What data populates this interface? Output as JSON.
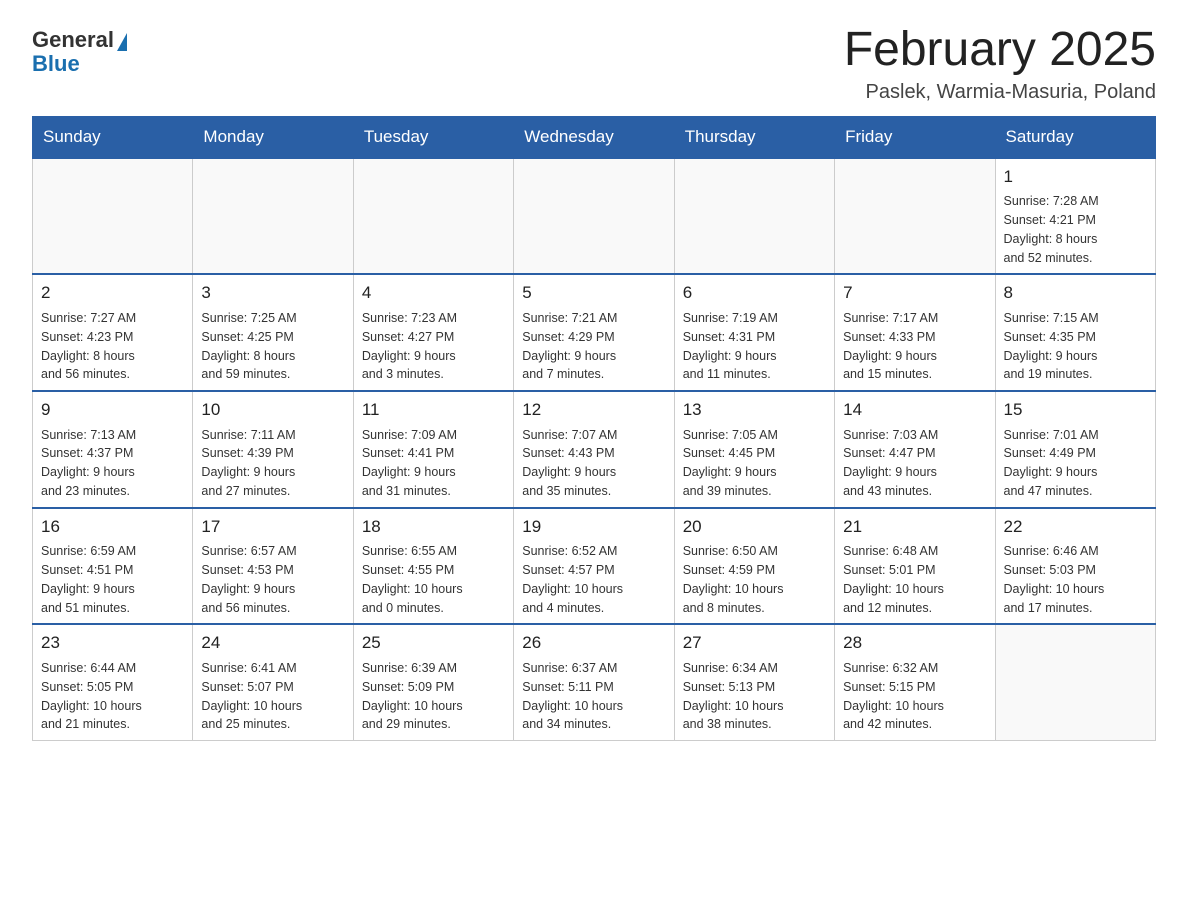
{
  "logo": {
    "general": "General",
    "blue": "Blue",
    "arrow_symbol": "▶"
  },
  "title": "February 2025",
  "subtitle": "Paslek, Warmia-Masuria, Poland",
  "weekdays": [
    "Sunday",
    "Monday",
    "Tuesday",
    "Wednesday",
    "Thursday",
    "Friday",
    "Saturday"
  ],
  "weeks": [
    [
      {
        "day": "",
        "info": ""
      },
      {
        "day": "",
        "info": ""
      },
      {
        "day": "",
        "info": ""
      },
      {
        "day": "",
        "info": ""
      },
      {
        "day": "",
        "info": ""
      },
      {
        "day": "",
        "info": ""
      },
      {
        "day": "1",
        "info": "Sunrise: 7:28 AM\nSunset: 4:21 PM\nDaylight: 8 hours\nand 52 minutes."
      }
    ],
    [
      {
        "day": "2",
        "info": "Sunrise: 7:27 AM\nSunset: 4:23 PM\nDaylight: 8 hours\nand 56 minutes."
      },
      {
        "day": "3",
        "info": "Sunrise: 7:25 AM\nSunset: 4:25 PM\nDaylight: 8 hours\nand 59 minutes."
      },
      {
        "day": "4",
        "info": "Sunrise: 7:23 AM\nSunset: 4:27 PM\nDaylight: 9 hours\nand 3 minutes."
      },
      {
        "day": "5",
        "info": "Sunrise: 7:21 AM\nSunset: 4:29 PM\nDaylight: 9 hours\nand 7 minutes."
      },
      {
        "day": "6",
        "info": "Sunrise: 7:19 AM\nSunset: 4:31 PM\nDaylight: 9 hours\nand 11 minutes."
      },
      {
        "day": "7",
        "info": "Sunrise: 7:17 AM\nSunset: 4:33 PM\nDaylight: 9 hours\nand 15 minutes."
      },
      {
        "day": "8",
        "info": "Sunrise: 7:15 AM\nSunset: 4:35 PM\nDaylight: 9 hours\nand 19 minutes."
      }
    ],
    [
      {
        "day": "9",
        "info": "Sunrise: 7:13 AM\nSunset: 4:37 PM\nDaylight: 9 hours\nand 23 minutes."
      },
      {
        "day": "10",
        "info": "Sunrise: 7:11 AM\nSunset: 4:39 PM\nDaylight: 9 hours\nand 27 minutes."
      },
      {
        "day": "11",
        "info": "Sunrise: 7:09 AM\nSunset: 4:41 PM\nDaylight: 9 hours\nand 31 minutes."
      },
      {
        "day": "12",
        "info": "Sunrise: 7:07 AM\nSunset: 4:43 PM\nDaylight: 9 hours\nand 35 minutes."
      },
      {
        "day": "13",
        "info": "Sunrise: 7:05 AM\nSunset: 4:45 PM\nDaylight: 9 hours\nand 39 minutes."
      },
      {
        "day": "14",
        "info": "Sunrise: 7:03 AM\nSunset: 4:47 PM\nDaylight: 9 hours\nand 43 minutes."
      },
      {
        "day": "15",
        "info": "Sunrise: 7:01 AM\nSunset: 4:49 PM\nDaylight: 9 hours\nand 47 minutes."
      }
    ],
    [
      {
        "day": "16",
        "info": "Sunrise: 6:59 AM\nSunset: 4:51 PM\nDaylight: 9 hours\nand 51 minutes."
      },
      {
        "day": "17",
        "info": "Sunrise: 6:57 AM\nSunset: 4:53 PM\nDaylight: 9 hours\nand 56 minutes."
      },
      {
        "day": "18",
        "info": "Sunrise: 6:55 AM\nSunset: 4:55 PM\nDaylight: 10 hours\nand 0 minutes."
      },
      {
        "day": "19",
        "info": "Sunrise: 6:52 AM\nSunset: 4:57 PM\nDaylight: 10 hours\nand 4 minutes."
      },
      {
        "day": "20",
        "info": "Sunrise: 6:50 AM\nSunset: 4:59 PM\nDaylight: 10 hours\nand 8 minutes."
      },
      {
        "day": "21",
        "info": "Sunrise: 6:48 AM\nSunset: 5:01 PM\nDaylight: 10 hours\nand 12 minutes."
      },
      {
        "day": "22",
        "info": "Sunrise: 6:46 AM\nSunset: 5:03 PM\nDaylight: 10 hours\nand 17 minutes."
      }
    ],
    [
      {
        "day": "23",
        "info": "Sunrise: 6:44 AM\nSunset: 5:05 PM\nDaylight: 10 hours\nand 21 minutes."
      },
      {
        "day": "24",
        "info": "Sunrise: 6:41 AM\nSunset: 5:07 PM\nDaylight: 10 hours\nand 25 minutes."
      },
      {
        "day": "25",
        "info": "Sunrise: 6:39 AM\nSunset: 5:09 PM\nDaylight: 10 hours\nand 29 minutes."
      },
      {
        "day": "26",
        "info": "Sunrise: 6:37 AM\nSunset: 5:11 PM\nDaylight: 10 hours\nand 34 minutes."
      },
      {
        "day": "27",
        "info": "Sunrise: 6:34 AM\nSunset: 5:13 PM\nDaylight: 10 hours\nand 38 minutes."
      },
      {
        "day": "28",
        "info": "Sunrise: 6:32 AM\nSunset: 5:15 PM\nDaylight: 10 hours\nand 42 minutes."
      },
      {
        "day": "",
        "info": ""
      }
    ]
  ]
}
